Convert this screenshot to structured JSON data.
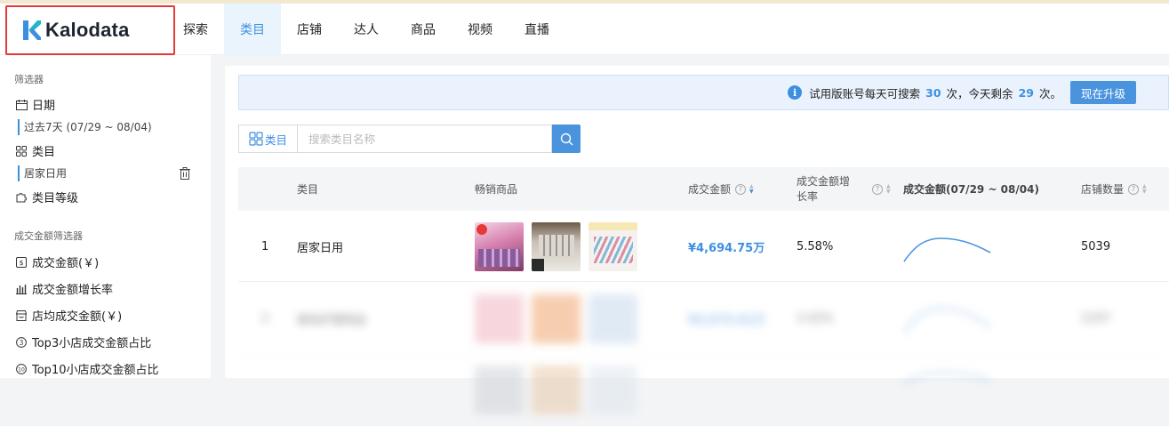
{
  "app": {
    "logo_text": "Kalodata"
  },
  "nav": [
    "探索",
    "类目",
    "店铺",
    "达人",
    "商品",
    "视频",
    "直播"
  ],
  "sidebar": {
    "filters_title": "筛选器",
    "date_label": "日期",
    "date_value": "过去7天 (07/29 ~ 08/04)",
    "category_label": "类目",
    "category_value": "居家日用",
    "category_level_label": "类目等级",
    "gmv_filters_title": "成交金额筛选器",
    "items": [
      "成交金额(￥)",
      "成交金额增长率",
      "店均成交金额(￥)",
      "Top3小店成交金额占比",
      "Top10小店成交金额占比"
    ]
  },
  "banner": {
    "text_a": "试用版账号每天可搜索",
    "daily_count": "30",
    "text_b": "次，今天剩余",
    "remaining": "29",
    "text_c": "次。",
    "upgrade_label": "现在升级"
  },
  "search": {
    "category_button": "类目",
    "placeholder": "搜索类目名称"
  },
  "table": {
    "columns": [
      "类目",
      "畅销商品",
      "成交金额",
      "成交金额增长率",
      "成交金额(07/29 ~ 08/04)",
      "店铺数量"
    ],
    "rows": [
      {
        "rank": "1",
        "category": "居家日用",
        "gmv": "¥4,694.75万",
        "growth": "5.58%",
        "shops": "5039"
      },
      {
        "rank": "2",
        "category": "美妆护理用品",
        "gmv": "¥3,975.61万",
        "growth": "3.42%",
        "shops": "2197"
      }
    ]
  },
  "colors": {
    "accent": "#3d8fe0",
    "highlight_border": "#e53935"
  }
}
